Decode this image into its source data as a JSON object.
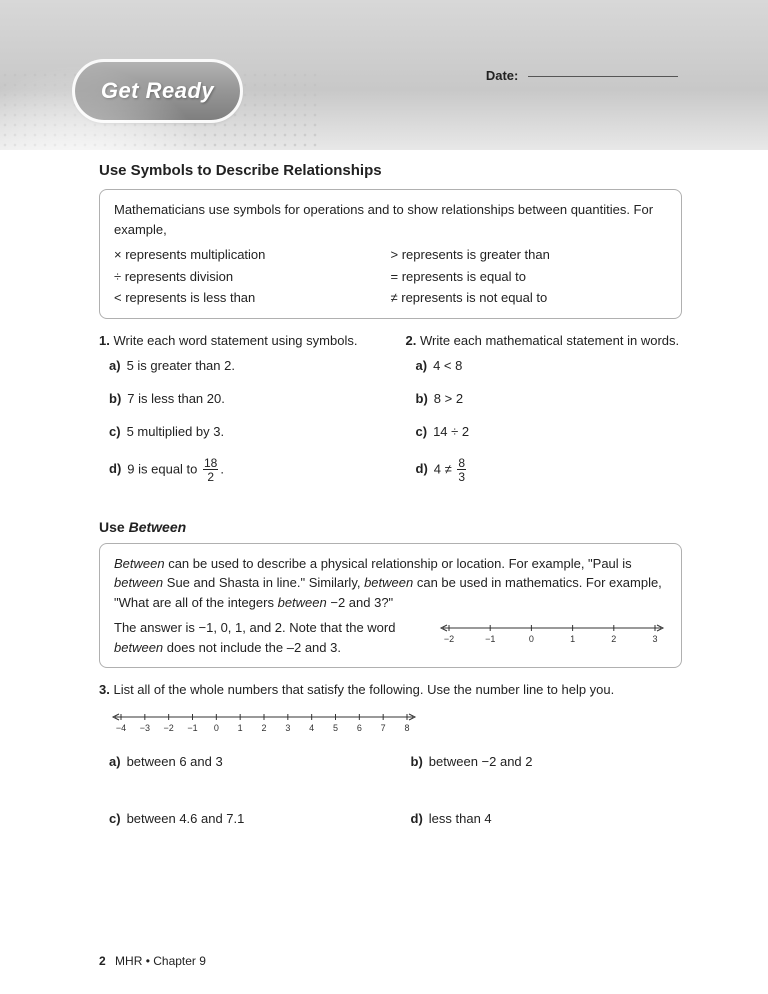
{
  "header": {
    "title": "Get Ready",
    "dateLabel": "Date:"
  },
  "section1": {
    "title": "Use Symbols to Describe Relationships",
    "intro": "Mathematicians use symbols for operations and to show relationships between quantities. For example,",
    "symbols": [
      "× represents multiplication",
      "> represents is greater than",
      "÷ represents division",
      "= represents is equal to",
      "< represents is less than",
      "≠ represents is not equal to"
    ],
    "q1": {
      "num": "1.",
      "text": "Write each word statement using symbols.",
      "a": "5 is greater than 2.",
      "b": "7 is less than 20.",
      "c": "5 multiplied by 3.",
      "dPre": "9 is equal to ",
      "dFracTop": "18",
      "dFracBot": "2",
      "dPost": "."
    },
    "q2": {
      "num": "2.",
      "text": "Write each mathematical statement in words.",
      "a": "4 < 8",
      "b": "8 > 2",
      "c": "14 ÷ 2",
      "dPre": "4 ≠ ",
      "dFracTop": "8",
      "dFracBot": "3"
    }
  },
  "section2": {
    "title": "Use ",
    "titleEm": "Between",
    "p1a": "Between",
    "p1b": " can be used to describe a physical relationship or location. For example, \"Paul is ",
    "p1c": "between",
    "p1d": " Sue and Shasta in line.\" Similarly, ",
    "p1e": "between",
    "p1f": " can be used in mathematics. For example, \"What are all of the integers ",
    "p1g": "between",
    "p1h": " −2 and 3?\"",
    "p2a": "The answer is −1, 0, 1, and 2. Note that the word ",
    "p2b": "between",
    "p2c": " does not include the –2 and 3.",
    "ticks1": [
      "−2",
      "−1",
      "0",
      "1",
      "2",
      "3"
    ],
    "q3": {
      "num": "3.",
      "text": "List all of the whole numbers that satisfy the following. Use the number line to help you.",
      "ticks": [
        "−4",
        "−3",
        "−2",
        "−1",
        "0",
        "1",
        "2",
        "3",
        "4",
        "5",
        "6",
        "7",
        "8"
      ],
      "a": "between 6 and 3",
      "b": "between −2 and 2",
      "c": "between 4.6 and 7.1",
      "d": "less than 4"
    }
  },
  "footer": {
    "page": "2",
    "text": "MHR • Chapter 9"
  },
  "labels": {
    "a": "a)",
    "b": "b)",
    "c": "c)",
    "d": "d)"
  }
}
